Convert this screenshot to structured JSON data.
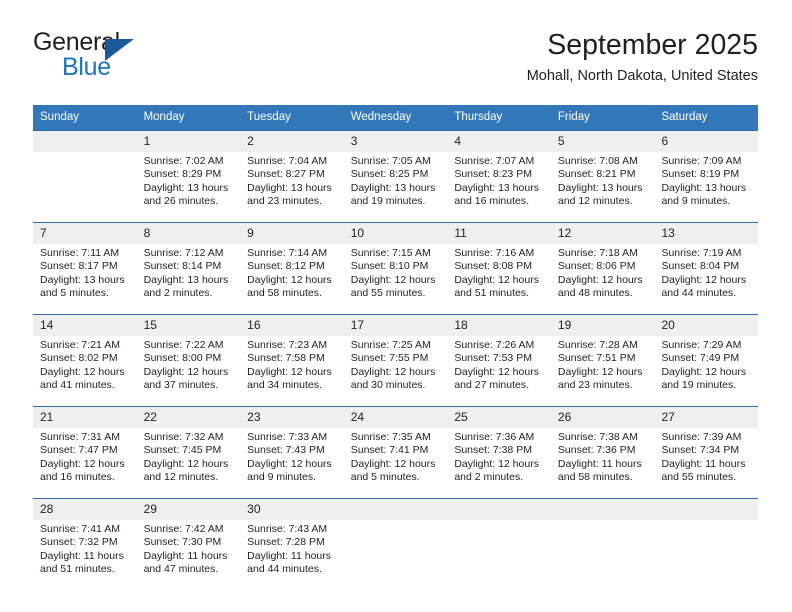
{
  "logo": {
    "word1": "General",
    "word2": "Blue",
    "triangle_color": "#1b5a99",
    "blue_color": "#1b75bb"
  },
  "header": {
    "title": "September 2025",
    "subtitle": "Mohall, North Dakota, United States",
    "bar_color": "#3277b8",
    "numbers_band_color": "#efefef"
  },
  "weekdays": [
    "Sunday",
    "Monday",
    "Tuesday",
    "Wednesday",
    "Thursday",
    "Friday",
    "Saturday"
  ],
  "labels": {
    "sunrise": "Sunrise:",
    "sunset": "Sunset:",
    "daylight": "Daylight:"
  },
  "weeks": [
    {
      "days": [
        {
          "num": "",
          "l1": "",
          "l2": "",
          "l3": "",
          "l4": ""
        },
        {
          "num": "1",
          "l1": "Sunrise: 7:02 AM",
          "l2": "Sunset: 8:29 PM",
          "l3": "Daylight: 13 hours",
          "l4": "and 26 minutes."
        },
        {
          "num": "2",
          "l1": "Sunrise: 7:04 AM",
          "l2": "Sunset: 8:27 PM",
          "l3": "Daylight: 13 hours",
          "l4": "and 23 minutes."
        },
        {
          "num": "3",
          "l1": "Sunrise: 7:05 AM",
          "l2": "Sunset: 8:25 PM",
          "l3": "Daylight: 13 hours",
          "l4": "and 19 minutes."
        },
        {
          "num": "4",
          "l1": "Sunrise: 7:07 AM",
          "l2": "Sunset: 8:23 PM",
          "l3": "Daylight: 13 hours",
          "l4": "and 16 minutes."
        },
        {
          "num": "5",
          "l1": "Sunrise: 7:08 AM",
          "l2": "Sunset: 8:21 PM",
          "l3": "Daylight: 13 hours",
          "l4": "and 12 minutes."
        },
        {
          "num": "6",
          "l1": "Sunrise: 7:09 AM",
          "l2": "Sunset: 8:19 PM",
          "l3": "Daylight: 13 hours",
          "l4": "and 9 minutes."
        }
      ]
    },
    {
      "days": [
        {
          "num": "7",
          "l1": "Sunrise: 7:11 AM",
          "l2": "Sunset: 8:17 PM",
          "l3": "Daylight: 13 hours",
          "l4": "and 5 minutes."
        },
        {
          "num": "8",
          "l1": "Sunrise: 7:12 AM",
          "l2": "Sunset: 8:14 PM",
          "l3": "Daylight: 13 hours",
          "l4": "and 2 minutes."
        },
        {
          "num": "9",
          "l1": "Sunrise: 7:14 AM",
          "l2": "Sunset: 8:12 PM",
          "l3": "Daylight: 12 hours",
          "l4": "and 58 minutes."
        },
        {
          "num": "10",
          "l1": "Sunrise: 7:15 AM",
          "l2": "Sunset: 8:10 PM",
          "l3": "Daylight: 12 hours",
          "l4": "and 55 minutes."
        },
        {
          "num": "11",
          "l1": "Sunrise: 7:16 AM",
          "l2": "Sunset: 8:08 PM",
          "l3": "Daylight: 12 hours",
          "l4": "and 51 minutes."
        },
        {
          "num": "12",
          "l1": "Sunrise: 7:18 AM",
          "l2": "Sunset: 8:06 PM",
          "l3": "Daylight: 12 hours",
          "l4": "and 48 minutes."
        },
        {
          "num": "13",
          "l1": "Sunrise: 7:19 AM",
          "l2": "Sunset: 8:04 PM",
          "l3": "Daylight: 12 hours",
          "l4": "and 44 minutes."
        }
      ]
    },
    {
      "days": [
        {
          "num": "14",
          "l1": "Sunrise: 7:21 AM",
          "l2": "Sunset: 8:02 PM",
          "l3": "Daylight: 12 hours",
          "l4": "and 41 minutes."
        },
        {
          "num": "15",
          "l1": "Sunrise: 7:22 AM",
          "l2": "Sunset: 8:00 PM",
          "l3": "Daylight: 12 hours",
          "l4": "and 37 minutes."
        },
        {
          "num": "16",
          "l1": "Sunrise: 7:23 AM",
          "l2": "Sunset: 7:58 PM",
          "l3": "Daylight: 12 hours",
          "l4": "and 34 minutes."
        },
        {
          "num": "17",
          "l1": "Sunrise: 7:25 AM",
          "l2": "Sunset: 7:55 PM",
          "l3": "Daylight: 12 hours",
          "l4": "and 30 minutes."
        },
        {
          "num": "18",
          "l1": "Sunrise: 7:26 AM",
          "l2": "Sunset: 7:53 PM",
          "l3": "Daylight: 12 hours",
          "l4": "and 27 minutes."
        },
        {
          "num": "19",
          "l1": "Sunrise: 7:28 AM",
          "l2": "Sunset: 7:51 PM",
          "l3": "Daylight: 12 hours",
          "l4": "and 23 minutes."
        },
        {
          "num": "20",
          "l1": "Sunrise: 7:29 AM",
          "l2": "Sunset: 7:49 PM",
          "l3": "Daylight: 12 hours",
          "l4": "and 19 minutes."
        }
      ]
    },
    {
      "days": [
        {
          "num": "21",
          "l1": "Sunrise: 7:31 AM",
          "l2": "Sunset: 7:47 PM",
          "l3": "Daylight: 12 hours",
          "l4": "and 16 minutes."
        },
        {
          "num": "22",
          "l1": "Sunrise: 7:32 AM",
          "l2": "Sunset: 7:45 PM",
          "l3": "Daylight: 12 hours",
          "l4": "and 12 minutes."
        },
        {
          "num": "23",
          "l1": "Sunrise: 7:33 AM",
          "l2": "Sunset: 7:43 PM",
          "l3": "Daylight: 12 hours",
          "l4": "and 9 minutes."
        },
        {
          "num": "24",
          "l1": "Sunrise: 7:35 AM",
          "l2": "Sunset: 7:41 PM",
          "l3": "Daylight: 12 hours",
          "l4": "and 5 minutes."
        },
        {
          "num": "25",
          "l1": "Sunrise: 7:36 AM",
          "l2": "Sunset: 7:38 PM",
          "l3": "Daylight: 12 hours",
          "l4": "and 2 minutes."
        },
        {
          "num": "26",
          "l1": "Sunrise: 7:38 AM",
          "l2": "Sunset: 7:36 PM",
          "l3": "Daylight: 11 hours",
          "l4": "and 58 minutes."
        },
        {
          "num": "27",
          "l1": "Sunrise: 7:39 AM",
          "l2": "Sunset: 7:34 PM",
          "l3": "Daylight: 11 hours",
          "l4": "and 55 minutes."
        }
      ]
    },
    {
      "days": [
        {
          "num": "28",
          "l1": "Sunrise: 7:41 AM",
          "l2": "Sunset: 7:32 PM",
          "l3": "Daylight: 11 hours",
          "l4": "and 51 minutes."
        },
        {
          "num": "29",
          "l1": "Sunrise: 7:42 AM",
          "l2": "Sunset: 7:30 PM",
          "l3": "Daylight: 11 hours",
          "l4": "and 47 minutes."
        },
        {
          "num": "30",
          "l1": "Sunrise: 7:43 AM",
          "l2": "Sunset: 7:28 PM",
          "l3": "Daylight: 11 hours",
          "l4": "and 44 minutes."
        },
        {
          "num": "",
          "l1": "",
          "l2": "",
          "l3": "",
          "l4": ""
        },
        {
          "num": "",
          "l1": "",
          "l2": "",
          "l3": "",
          "l4": ""
        },
        {
          "num": "",
          "l1": "",
          "l2": "",
          "l3": "",
          "l4": ""
        },
        {
          "num": "",
          "l1": "",
          "l2": "",
          "l3": "",
          "l4": ""
        }
      ]
    }
  ]
}
